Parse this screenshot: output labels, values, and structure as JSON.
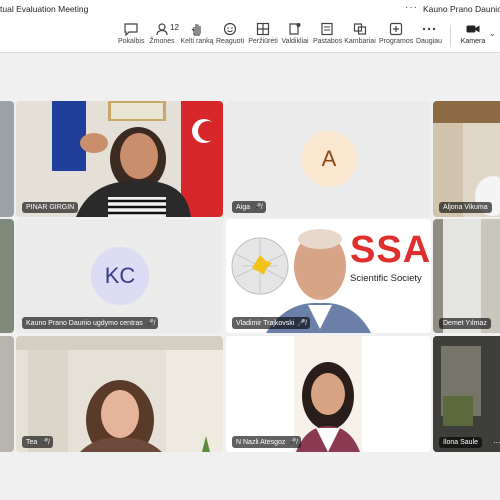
{
  "window": {
    "title": "tual Evaluation Meeting",
    "org_label": "Kauno Prano Daunio ugd",
    "more_dots": "···"
  },
  "toolbar": {
    "items": [
      {
        "label": "Pokalbis",
        "icon": "chat-icon"
      },
      {
        "label": "Žmonės",
        "icon": "people-icon",
        "count": "12"
      },
      {
        "label": "Kelti ranką",
        "icon": "raise-hand-icon"
      },
      {
        "label": "Reaguoti",
        "icon": "react-icon"
      },
      {
        "label": "Peržiūrėti",
        "icon": "view-icon"
      },
      {
        "label": "Valdikliai",
        "icon": "apps-icon"
      },
      {
        "label": "Pastabos",
        "icon": "notes-icon"
      },
      {
        "label": "Kambariai",
        "icon": "rooms-icon"
      },
      {
        "label": "Programos",
        "icon": "add-apps-icon"
      },
      {
        "label": "Daugiau",
        "icon": "more-icon"
      }
    ],
    "camera": {
      "label": "Kamera",
      "icon": "camera-icon"
    }
  },
  "participants": [
    {
      "name": "PINAR GIRGIN",
      "kind": "video",
      "muted": false
    },
    {
      "name": "Aiga",
      "kind": "avatar",
      "initials": "A",
      "muted": true
    },
    {
      "name": "Aljona Vikuma",
      "kind": "video",
      "muted": false
    },
    {
      "name": "Kauno Prano Daunio ugdymo centras",
      "kind": "avatar",
      "initials": "KC",
      "muted": true
    },
    {
      "name": "Vladimir Trajkovski",
      "kind": "video",
      "muted": true
    },
    {
      "name": "Demet Yılmaz",
      "kind": "video",
      "muted": false
    },
    {
      "name": "Tea",
      "kind": "video",
      "muted": true
    },
    {
      "name": "N Nazli Atesgoz",
      "kind": "video",
      "muted": true
    },
    {
      "name": "Ilona Saule",
      "kind": "video",
      "muted": false
    }
  ],
  "video_content": {
    "logo_text": "SSA",
    "logo_subtext": "Scientific Society"
  },
  "colors": {
    "avatar_a_bg": "#fbe6cf",
    "avatar_a_fg": "#8a4b18",
    "avatar_kc_bg": "#dcdcf5",
    "avatar_kc_fg": "#3b3b8f",
    "logo_red": "#e0302d"
  }
}
